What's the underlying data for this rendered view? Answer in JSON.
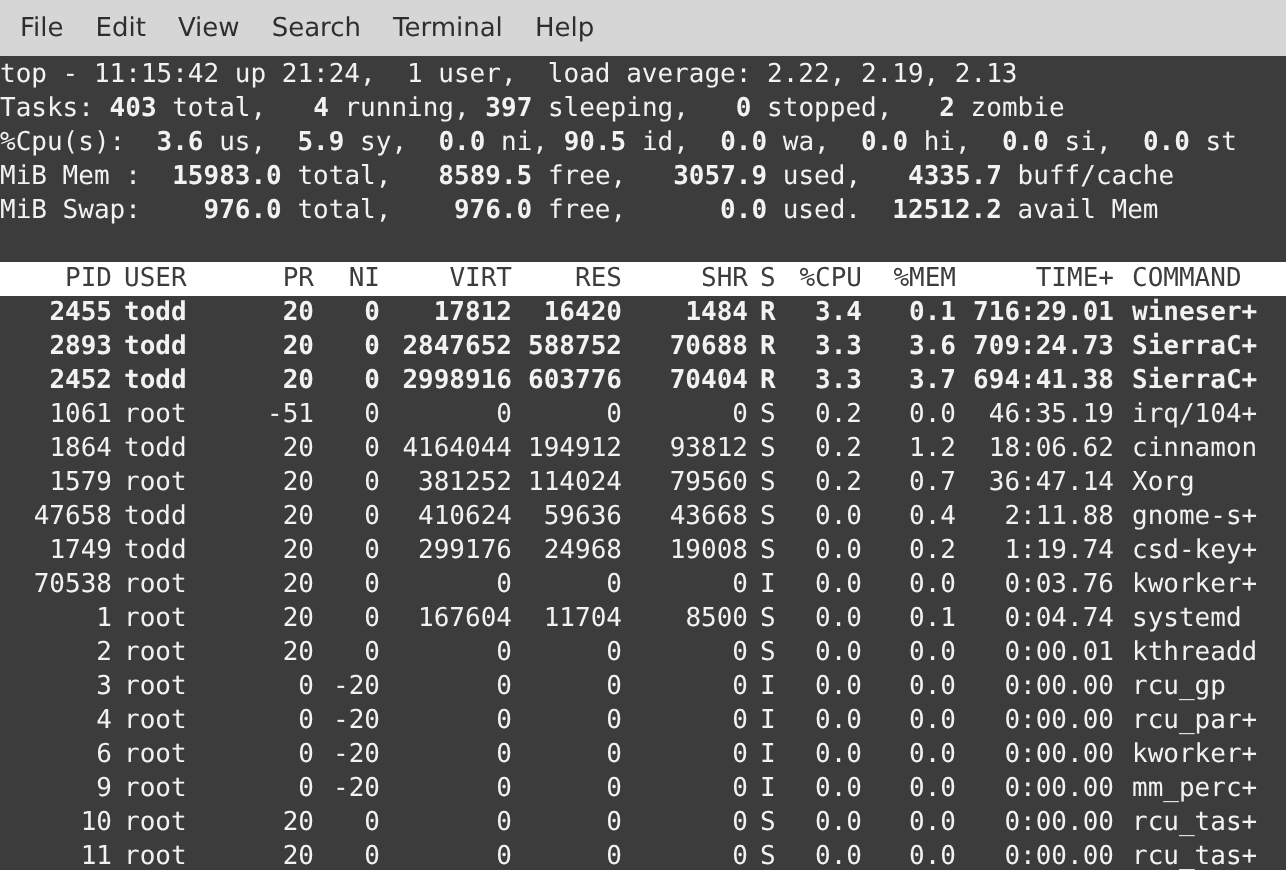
{
  "menu": [
    "File",
    "Edit",
    "View",
    "Search",
    "Terminal",
    "Help"
  ],
  "summary": [
    "top - 11:15:42 up 21:24,  1 user,  load average: 2.22, 2.19, 2.13",
    "Tasks: **403** total,   **4** running, **397** sleeping,   **0** stopped,   **2** zombie",
    "%Cpu(s):  **3.6** us,  **5.9** sy,  **0.0** ni, **90.5** id,  **0.0** wa,  **0.0** hi,  **0.0** si,  **0.0** st",
    "MiB Mem :  **15983.0** total,   **8589.5** free,   **3057.9** used,   **4335.7** buff/cache",
    "MiB Swap:    **976.0** total,    **976.0** free,      **0.0** used.  **12512.2** avail Mem"
  ],
  "table": {
    "columns": [
      "PID",
      "USER",
      "PR",
      "NI",
      "VIRT",
      "RES",
      "SHR",
      "S",
      "%CPU",
      "%MEM",
      "TIME+",
      "COMMAND"
    ],
    "rows": [
      {
        "highlighted": true,
        "cells": [
          "2455",
          "todd",
          "20",
          "0",
          "17812",
          "16420",
          "1484",
          "R",
          "3.4",
          "0.1",
          "716:29.01",
          "wineser+"
        ]
      },
      {
        "highlighted": true,
        "cells": [
          "2893",
          "todd",
          "20",
          "0",
          "2847652",
          "588752",
          "70688",
          "R",
          "3.3",
          "3.6",
          "709:24.73",
          "SierraC+"
        ]
      },
      {
        "highlighted": true,
        "cells": [
          "2452",
          "todd",
          "20",
          "0",
          "2998916",
          "603776",
          "70404",
          "R",
          "3.3",
          "3.7",
          "694:41.38",
          "SierraC+"
        ]
      },
      {
        "highlighted": false,
        "cells": [
          "1061",
          "root",
          "-51",
          "0",
          "0",
          "0",
          "0",
          "S",
          "0.2",
          "0.0",
          "46:35.19",
          "irq/104+"
        ]
      },
      {
        "highlighted": false,
        "cells": [
          "1864",
          "todd",
          "20",
          "0",
          "4164044",
          "194912",
          "93812",
          "S",
          "0.2",
          "1.2",
          "18:06.62",
          "cinnamon"
        ]
      },
      {
        "highlighted": false,
        "cells": [
          "1579",
          "root",
          "20",
          "0",
          "381252",
          "114024",
          "79560",
          "S",
          "0.2",
          "0.7",
          "36:47.14",
          "Xorg"
        ]
      },
      {
        "highlighted": false,
        "cells": [
          "47658",
          "todd",
          "20",
          "0",
          "410624",
          "59636",
          "43668",
          "S",
          "0.0",
          "0.4",
          "2:11.88",
          "gnome-s+"
        ]
      },
      {
        "highlighted": false,
        "cells": [
          "1749",
          "todd",
          "20",
          "0",
          "299176",
          "24968",
          "19008",
          "S",
          "0.0",
          "0.2",
          "1:19.74",
          "csd-key+"
        ]
      },
      {
        "highlighted": false,
        "cells": [
          "70538",
          "root",
          "20",
          "0",
          "0",
          "0",
          "0",
          "I",
          "0.0",
          "0.0",
          "0:03.76",
          "kworker+"
        ]
      },
      {
        "highlighted": false,
        "cells": [
          "1",
          "root",
          "20",
          "0",
          "167604",
          "11704",
          "8500",
          "S",
          "0.0",
          "0.1",
          "0:04.74",
          "systemd"
        ]
      },
      {
        "highlighted": false,
        "cells": [
          "2",
          "root",
          "20",
          "0",
          "0",
          "0",
          "0",
          "S",
          "0.0",
          "0.0",
          "0:00.01",
          "kthreadd"
        ]
      },
      {
        "highlighted": false,
        "cells": [
          "3",
          "root",
          "0",
          "-20",
          "0",
          "0",
          "0",
          "I",
          "0.0",
          "0.0",
          "0:00.00",
          "rcu_gp"
        ]
      },
      {
        "highlighted": false,
        "cells": [
          "4",
          "root",
          "0",
          "-20",
          "0",
          "0",
          "0",
          "I",
          "0.0",
          "0.0",
          "0:00.00",
          "rcu_par+"
        ]
      },
      {
        "highlighted": false,
        "cells": [
          "6",
          "root",
          "0",
          "-20",
          "0",
          "0",
          "0",
          "I",
          "0.0",
          "0.0",
          "0:00.00",
          "kworker+"
        ]
      },
      {
        "highlighted": false,
        "cells": [
          "9",
          "root",
          "0",
          "-20",
          "0",
          "0",
          "0",
          "I",
          "0.0",
          "0.0",
          "0:00.00",
          "mm_perc+"
        ]
      },
      {
        "highlighted": false,
        "cells": [
          "10",
          "root",
          "20",
          "0",
          "0",
          "0",
          "0",
          "S",
          "0.0",
          "0.0",
          "0:00.00",
          "rcu_tas+"
        ]
      },
      {
        "highlighted": false,
        "cells": [
          "11",
          "root",
          "20",
          "0",
          "0",
          "0",
          "0",
          "S",
          "0.0",
          "0.0",
          "0:00.00",
          "rcu_tas+"
        ]
      }
    ]
  }
}
